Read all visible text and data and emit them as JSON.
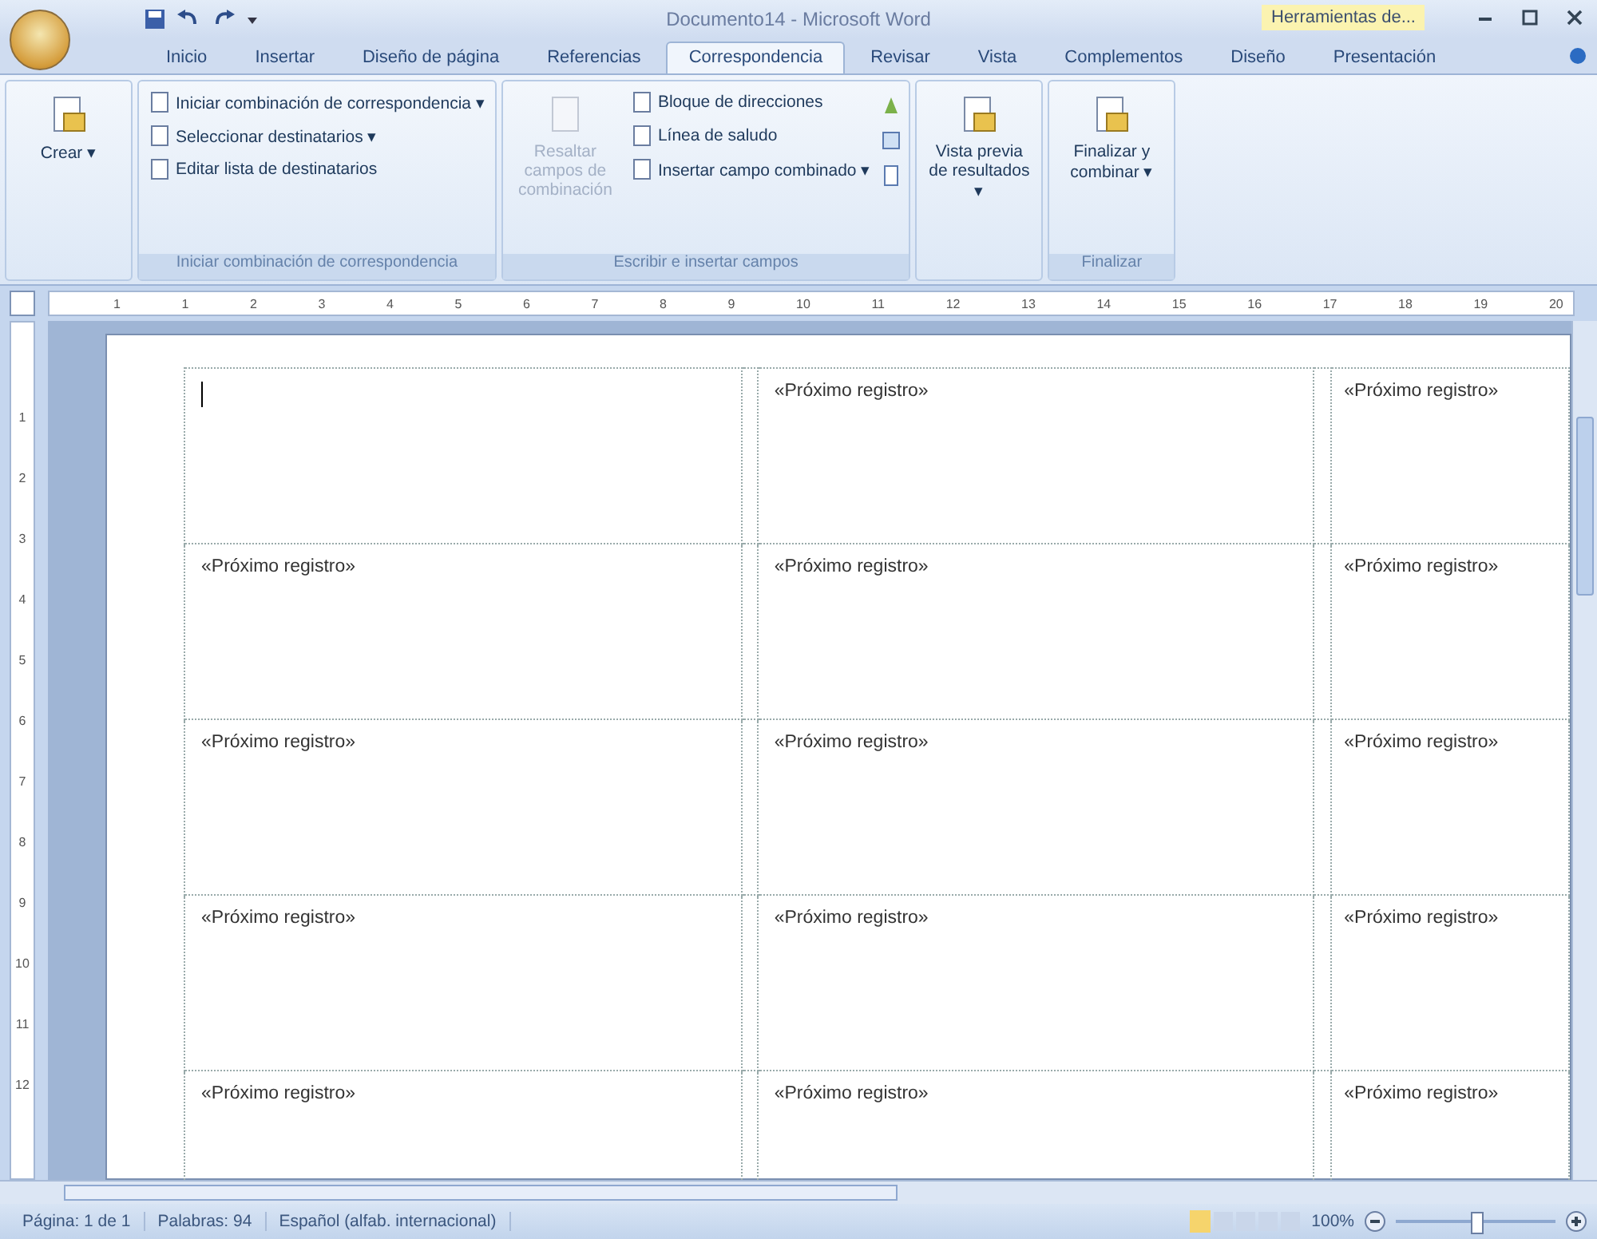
{
  "window": {
    "title": "Documento14 - Microsoft Word",
    "context_tab_group": "Herramientas de..."
  },
  "tabs": [
    {
      "label": "Inicio",
      "selected": false
    },
    {
      "label": "Insertar",
      "selected": false
    },
    {
      "label": "Diseño de página",
      "selected": false
    },
    {
      "label": "Referencias",
      "selected": false
    },
    {
      "label": "Correspondencia",
      "selected": true
    },
    {
      "label": "Revisar",
      "selected": false
    },
    {
      "label": "Vista",
      "selected": false
    },
    {
      "label": "Complementos",
      "selected": false
    },
    {
      "label": "Diseño",
      "selected": false
    },
    {
      "label": "Presentación",
      "selected": false
    }
  ],
  "ribbon": {
    "groups": [
      {
        "kind": "large",
        "items": [
          {
            "label": "Crear ▾",
            "disabled": false
          }
        ]
      },
      {
        "label": "Iniciar combinación de correspondencia",
        "kind": "list",
        "items": [
          {
            "label": "Iniciar combinación de correspondencia ▾",
            "disabled": false
          },
          {
            "label": "Seleccionar destinatarios ▾",
            "disabled": false
          },
          {
            "label": "Editar lista de destinatarios",
            "disabled": false
          }
        ]
      },
      {
        "label": "Escribir e insertar campos",
        "kind": "mixed",
        "items": [
          {
            "label": "Resaltar campos de combinación",
            "disabled": true
          },
          {
            "label": "Bloque de direcciones",
            "disabled": false
          },
          {
            "label": "Línea de saludo",
            "disabled": false
          },
          {
            "label": "Insertar campo combinado ▾",
            "disabled": false
          }
        ]
      },
      {
        "kind": "large",
        "items": [
          {
            "label": "Vista previa de resultados ▾",
            "disabled": false
          }
        ]
      },
      {
        "label": "Finalizar",
        "kind": "large",
        "items": [
          {
            "label": "Finalizar y combinar ▾",
            "disabled": false
          }
        ]
      }
    ]
  },
  "ruler": {
    "numbers": [
      "1",
      "1",
      "2",
      "3",
      "4",
      "5",
      "6",
      "7",
      "8",
      "9",
      "10",
      "11",
      "12",
      "13",
      "14",
      "15",
      "16",
      "17",
      "18",
      "19",
      "20"
    ]
  },
  "vertical_ruler": {
    "numbers": [
      "1",
      "2",
      "3",
      "4",
      "5",
      "6",
      "7",
      "8",
      "9",
      "10",
      "11",
      "12"
    ]
  },
  "table": {
    "rows": [
      [
        {
          "cursor": true
        },
        {
          "text": "«Próximo registro»",
          "cursor": false
        },
        {
          "text": "«Próximo registro»",
          "cursor": false
        }
      ],
      [
        {
          "text": "«Próximo registro»",
          "cursor": false
        },
        {
          "text": "«Próximo registro»",
          "cursor": false
        },
        {
          "text": "«Próximo registro»",
          "cursor": false
        }
      ],
      [
        {
          "text": "«Próximo registro»",
          "cursor": false
        },
        {
          "text": "«Próximo registro»",
          "cursor": false
        },
        {
          "text": "«Próximo registro»",
          "cursor": false
        }
      ],
      [
        {
          "text": "«Próximo registro»",
          "cursor": false
        },
        {
          "text": "«Próximo registro»",
          "cursor": false
        },
        {
          "text": "«Próximo registro»",
          "cursor": false
        }
      ],
      [
        {
          "text": "«Próximo registro»",
          "cursor": false
        },
        {
          "text": "«Próximo registro»",
          "cursor": false
        },
        {
          "text": "«Próximo registro»",
          "cursor": false
        }
      ]
    ]
  },
  "status_bar": {
    "items": [
      "Página: 1 de 1",
      "Palabras: 94",
      "Español (alfab. internacional)"
    ],
    "zoom": "100%",
    "zoom_slider": {
      "level": 0.5
    }
  }
}
